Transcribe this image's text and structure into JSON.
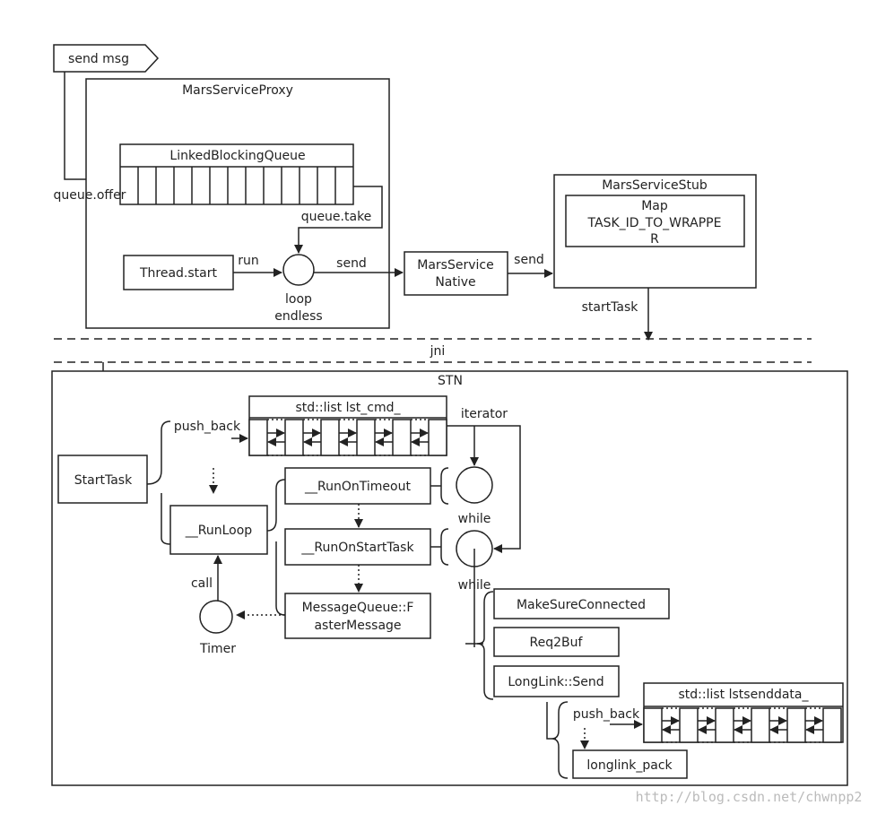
{
  "send_msg": "send msg",
  "proxy": {
    "title": "MarsServiceProxy",
    "queue": "LinkedBlockingQueue",
    "offer": "queue.offer",
    "take": "queue.take",
    "thread": "Thread.start",
    "run": "run",
    "loop1": "loop",
    "loop2": "endless",
    "send": "send"
  },
  "native": {
    "line1": "MarsService",
    "line2": "Native",
    "send": "send"
  },
  "stub": {
    "title": "MarsServiceStub",
    "map1": "Map",
    "map2": "TASK_ID_TO_WRAPPE",
    "map3": "R",
    "start": "startTask"
  },
  "jni": "jni",
  "stn": {
    "title": "STN",
    "start_task": "StartTask",
    "lst_cmd": "std::list lst_cmd_",
    "push_back": "push_back",
    "iterator": "iterator",
    "run_loop": "__RunLoop",
    "call": "call",
    "timer": "Timer",
    "on_timeout": "__RunOnTimeout",
    "on_start": "__RunOnStartTask",
    "mq1": "MessageQueue::F",
    "mq2": "asterMessage",
    "while1": "while",
    "while2": "while",
    "make_sure": "MakeSureConnected",
    "req2buf": "Req2Buf",
    "send": "LongLink::Send",
    "push_back2": "push_back",
    "lstsend": "std::list lstsenddata_",
    "pack": "longlink_pack"
  },
  "watermark": "http://blog.csdn.net/chwnpp2"
}
